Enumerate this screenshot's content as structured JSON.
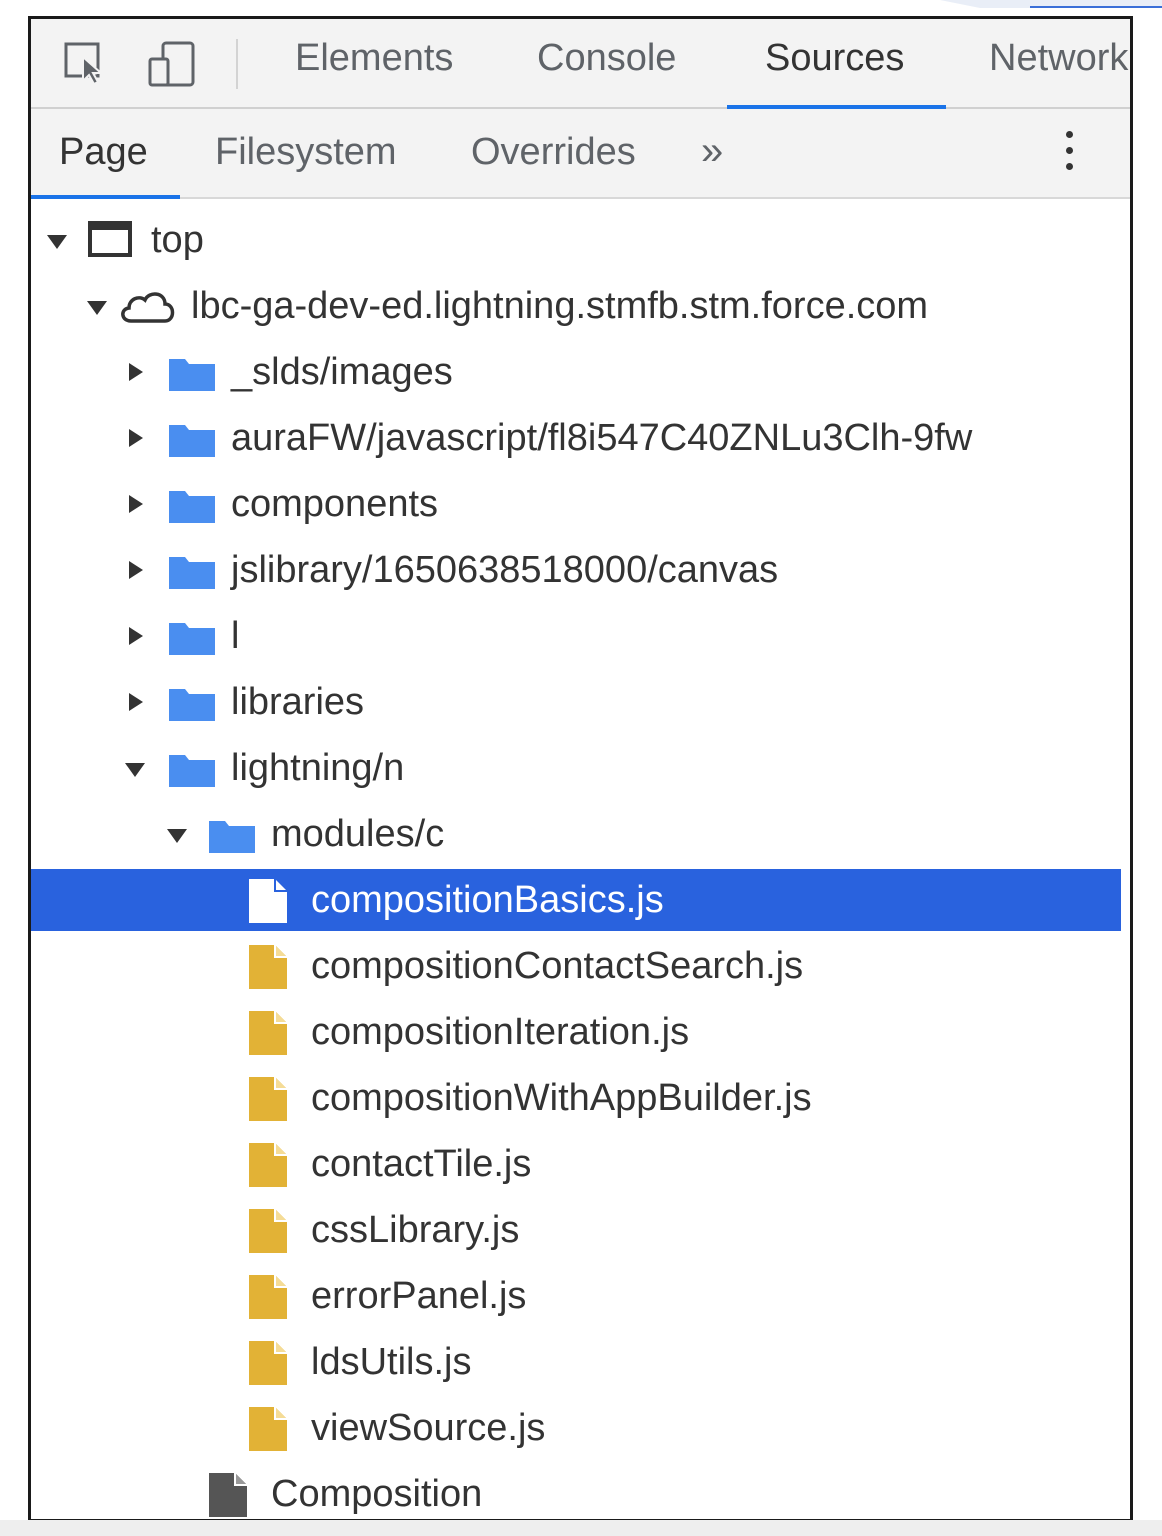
{
  "toolbar": {
    "tabs": [
      {
        "label": "Elements",
        "active": false
      },
      {
        "label": "Console",
        "active": false
      },
      {
        "label": "Sources",
        "active": true
      },
      {
        "label": "Network",
        "active": false
      }
    ],
    "inspect_icon": "inspect-element-icon",
    "device_icon": "device-toggle-icon"
  },
  "subbar": {
    "tabs": [
      {
        "label": "Page",
        "active": true
      },
      {
        "label": "Filesystem",
        "active": false
      },
      {
        "label": "Overrides",
        "active": false
      }
    ],
    "more_label": "»",
    "menu_icon": "kebab-menu-icon"
  },
  "tree": {
    "top_label": "top",
    "domain_label": "lbc-ga-dev-ed.lightning.stmfb.stm.force.com",
    "folders": [
      {
        "label": "_slds/images",
        "expanded": false
      },
      {
        "label": "auraFW/javascript/fl8i547C40ZNLu3Clh-9fw",
        "expanded": false
      },
      {
        "label": "components",
        "expanded": false
      },
      {
        "label": "jslibrary/1650638518000/canvas",
        "expanded": false
      },
      {
        "label": "l",
        "expanded": false
      },
      {
        "label": "libraries",
        "expanded": false
      },
      {
        "label": "lightning/n",
        "expanded": true
      }
    ],
    "subfolder": {
      "label": "modules/c",
      "expanded": true
    },
    "files": [
      {
        "label": "compositionBasics.js",
        "selected": true
      },
      {
        "label": "compositionContactSearch.js",
        "selected": false
      },
      {
        "label": "compositionIteration.js",
        "selected": false
      },
      {
        "label": "compositionWithAppBuilder.js",
        "selected": false
      },
      {
        "label": "contactTile.js",
        "selected": false
      },
      {
        "label": "cssLibrary.js",
        "selected": false
      },
      {
        "label": "errorPanel.js",
        "selected": false
      },
      {
        "label": "ldsUtils.js",
        "selected": false
      },
      {
        "label": "viewSource.js",
        "selected": false
      }
    ],
    "document_label": "Composition"
  },
  "colors": {
    "accent": "#1a73e8",
    "selection": "#2962de",
    "folder": "#4a8ef0",
    "js_file": "#e2b236",
    "document": "#555555"
  }
}
